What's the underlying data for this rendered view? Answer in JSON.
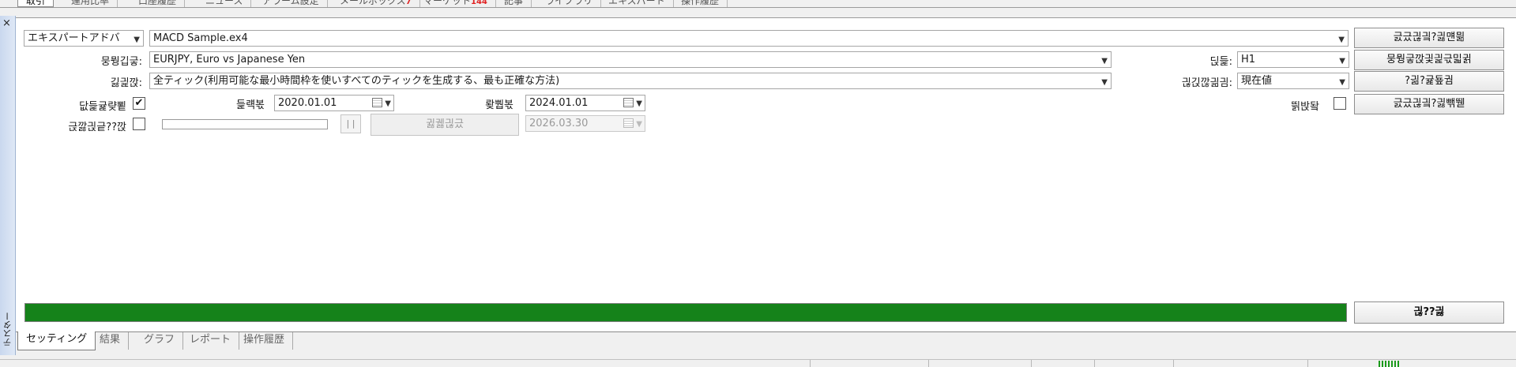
{
  "top_tabs": [
    {
      "label": "取引",
      "active": true
    },
    {
      "label": "運用比率"
    },
    {
      "label": "口座履歴"
    },
    {
      "label": "ニュース"
    },
    {
      "label": "アラーム設定"
    },
    {
      "label": "メールボックス",
      "badge": "7"
    },
    {
      "label": "マーケット",
      "badge": "144"
    },
    {
      "label": "記事"
    },
    {
      "label": "ライブラリ"
    },
    {
      "label": "エキスパート"
    },
    {
      "label": "操作履歴"
    }
  ],
  "side": {
    "close": "×",
    "label": "テスター"
  },
  "form": {
    "mode_select": "エキスパートアドバ",
    "expert_file": "MACD Sample.ex4",
    "symbol_label": "뭉뭥깁긓:",
    "symbol_value": "EURJPY, Euro vs Japanese Yen",
    "model_label": "긿긡깑:",
    "model_value": "全ティック(利用可能な最小時間枠を使いすべてのティックを生成する、最も正確な方法)",
    "use_date_label": "닶듩귩럊뾭",
    "use_date_checked": "✔",
    "from_label": "듩럑볷",
    "from_value": "2020.01.01",
    "to_label": "뢎뿹볷",
    "to_value": "2024.01.01",
    "visual_label": "귽깛긙긑??깑",
    "pause_label": "| |",
    "skip_button": "귏궳긚긌",
    "skip_date": "2026.03.30",
    "period_label": "딙듩:",
    "period_value": "H1",
    "spread_label": "긚긵깒긞긤:",
    "spread_value": "現在値",
    "optimize_label": "띍밙돸"
  },
  "buttons": {
    "expert_props": "긄긌긚긬?긣먠믦",
    "symbol_props": "뭉뭥긓깑긫긡귻밃귉",
    "open_chart": "?긞?귩둎궘",
    "modify_expert": "긄긌긚긬?긣빾뛛",
    "start": "긚??긣"
  },
  "progress": {
    "percent": 100,
    "color": "#15821a"
  },
  "bottom_tabs": [
    {
      "label": "セッティング",
      "active": true
    },
    {
      "label": "結果"
    },
    {
      "label": "グラフ"
    },
    {
      "label": "レポート"
    },
    {
      "label": "操作履歴"
    }
  ]
}
